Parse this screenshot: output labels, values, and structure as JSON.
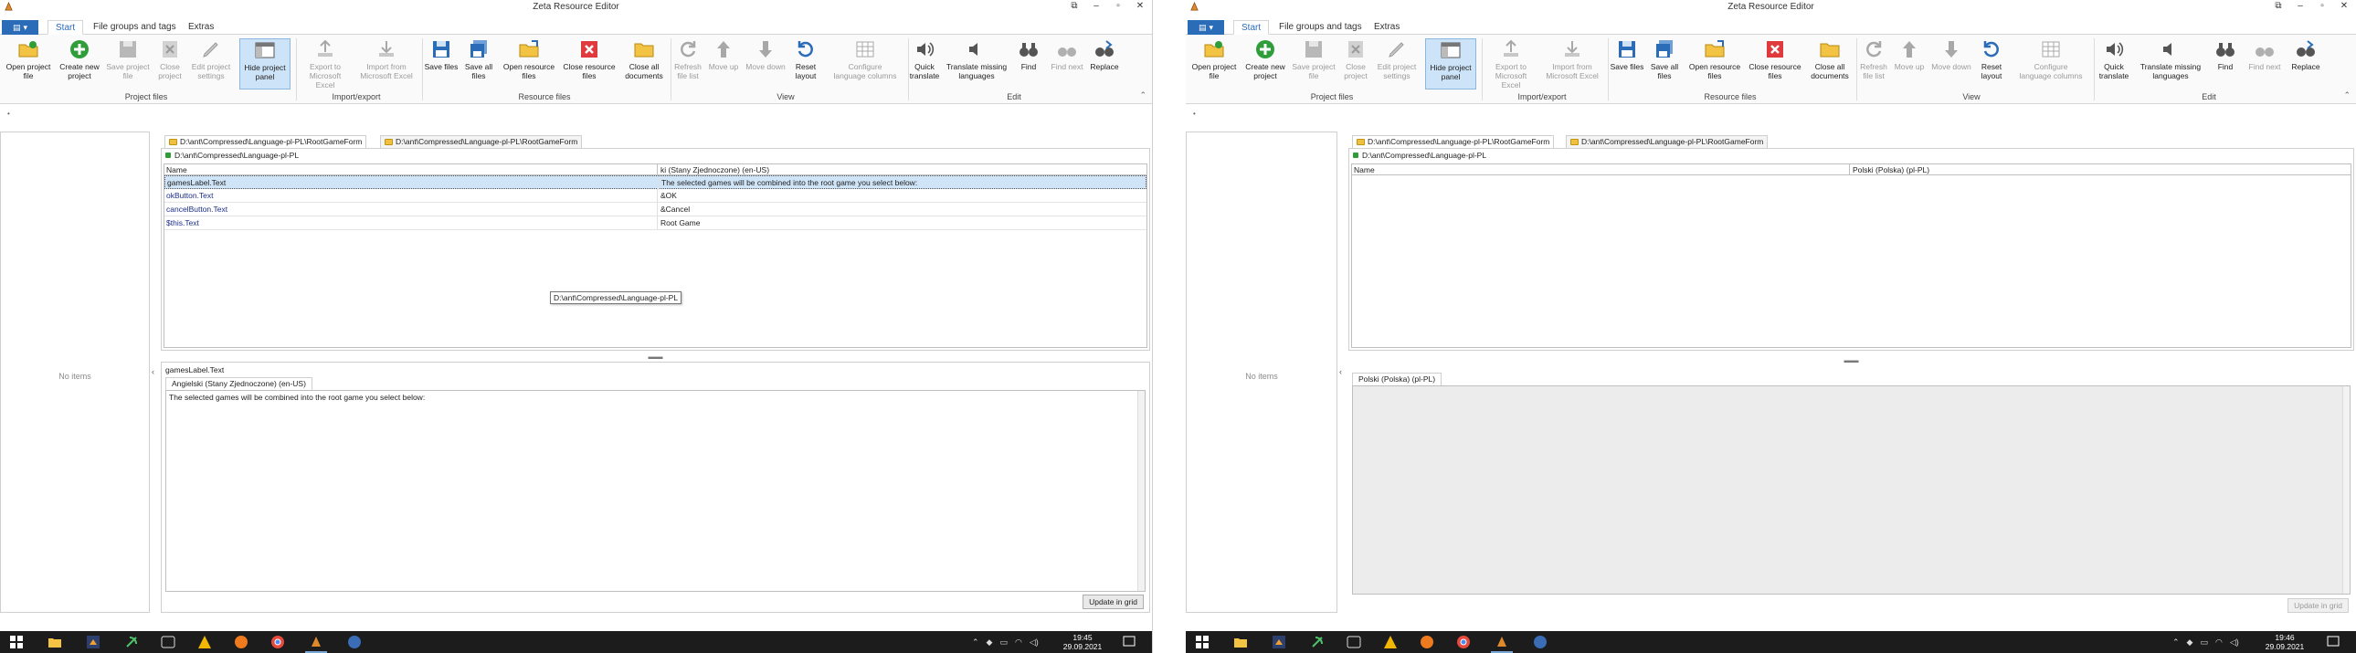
{
  "left": {
    "title": "Zeta Resource Editor",
    "menu_tabs": [
      "Start",
      "File groups and tags",
      "Extras"
    ],
    "ribbon": {
      "buttons": [
        {
          "label": "Open project\nfile"
        },
        {
          "label": "Create new\nproject"
        },
        {
          "label": "Save project\nfile"
        },
        {
          "label": "Close\nproject"
        },
        {
          "label": "Edit project\nsettings"
        },
        {
          "label": "Hide project\npanel"
        },
        {
          "label": "Export to\nMicrosoft Excel"
        },
        {
          "label": "Import from\nMicrosoft Excel"
        },
        {
          "label": "Save files"
        },
        {
          "label": "Save all\nfiles"
        },
        {
          "label": "Open resource\nfiles"
        },
        {
          "label": "Close resource\nfiles"
        },
        {
          "label": "Close all\ndocuments"
        },
        {
          "label": "Refresh\nfile list"
        },
        {
          "label": "Move up"
        },
        {
          "label": "Move down"
        },
        {
          "label": "Reset\nlayout"
        },
        {
          "label": "Configure\nlanguage columns"
        },
        {
          "label": "Quick\ntranslate"
        },
        {
          "label": "Translate missing\nlanguages"
        },
        {
          "label": "Find"
        },
        {
          "label": "Find next"
        },
        {
          "label": "Replace"
        }
      ],
      "groups": [
        "Project files",
        "Import/export",
        "Resource files",
        "View",
        "Edit"
      ]
    },
    "no_items": "No items",
    "doc_tabs": [
      "D:\\ant\\Compressed\\Language-pl-PL\\RootGameForm",
      "D:\\ant\\Compressed\\Language-pl-PL\\RootGameForm"
    ],
    "path": "D:\\ant\\Compressed\\Language-pl-PL",
    "tooltip": "D:\\ant\\Compressed\\Language-pl-PL",
    "grid": {
      "headers": [
        "Name",
        "Angielski (Stany Zjednoczone) (en-US)"
      ],
      "header2_visible": "ki (Stany Zjednoczone) (en-US)",
      "rows": [
        {
          "name": "gamesLabel.Text",
          "value": "The selected games will be combined into the root game you select below:"
        },
        {
          "name": "okButton.Text",
          "value": "&OK"
        },
        {
          "name": "cancelButton.Text",
          "value": "&Cancel"
        },
        {
          "name": "$this.Text",
          "value": "Root Game"
        }
      ]
    },
    "editor": {
      "key": "gamesLabel.Text",
      "lang_tab": "Angielski (Stany Zjednoczone) (en-US)",
      "text": "The selected games will be combined into the root game you select below:",
      "update_button": "Update in grid"
    },
    "clock": {
      "time": "19:45",
      "date": "29.09.2021"
    }
  },
  "right": {
    "title": "Zeta Resource Editor",
    "menu_tabs": [
      "Start",
      "File groups and tags",
      "Extras"
    ],
    "no_items": "No items",
    "doc_tabs": [
      "D:\\ant\\Compressed\\Language-pl-PL\\RootGameForm",
      "D:\\ant\\Compressed\\Language-pl-PL\\RootGameForm"
    ],
    "path": "D:\\ant\\Compressed\\Language-pl-PL",
    "grid": {
      "headers": [
        "Name",
        "Polski (Polska) (pl-PL)"
      ]
    },
    "editor": {
      "lang_tab": "Polski (Polska) (pl-PL)",
      "update_button": "Update in grid"
    },
    "clock": {
      "time": "19:46",
      "date": "29.09.2021"
    }
  },
  "colors": {
    "accent": "#2b6cb8",
    "selection": "#cfe4f7",
    "taskbar": "#1c1c1c"
  }
}
